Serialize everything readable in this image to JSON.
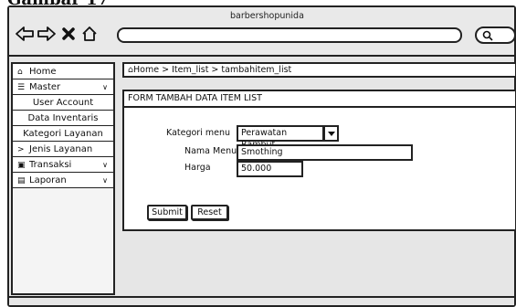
{
  "caption": "Gambar 17",
  "browser": {
    "site_title": "barbershopunida",
    "icons": [
      "back-arrow-icon",
      "forward-arrow-icon",
      "close-icon",
      "home-icon",
      "search-icon"
    ]
  },
  "sidebar": {
    "items": [
      {
        "label": "Home",
        "icon": "home-icon"
      },
      {
        "label": "Master",
        "icon": "database-icon"
      },
      {
        "label": "User Account"
      },
      {
        "label": "Data Inventaris"
      },
      {
        "label": "Kategori Layanan"
      },
      {
        "label": "Jenis Layanan",
        "prefix": ">"
      },
      {
        "label": "Transaksi",
        "icon": "card-icon"
      },
      {
        "label": "Laporan",
        "icon": "chart-icon"
      }
    ]
  },
  "breadcrumb": {
    "text": "Home > Item_list > tambahitem_list"
  },
  "form": {
    "title": "FORM TAMBAH DATA ITEM LIST",
    "kategori_label": "Kategori menu",
    "kategori_value": "Perawatan Rambut",
    "nama_label": "Nama Menu",
    "nama_value": "Smothing",
    "harga_label": "Harga",
    "harga_value": "50.000",
    "submit_label": "Submit",
    "reset_label": "Reset"
  }
}
